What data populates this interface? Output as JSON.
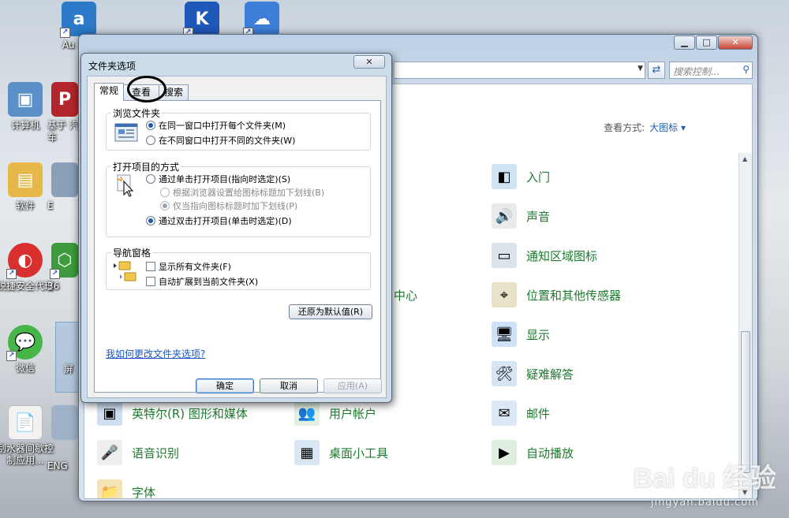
{
  "desktop": {
    "icons": [
      {
        "label": "Au 200",
        "glyph": "a",
        "bg": "#2b79c8"
      },
      {
        "label": "",
        "glyph": "K",
        "bg": "#1f58b8"
      },
      {
        "label": "",
        "glyph": "☁",
        "bg": "#3d7fd8"
      },
      {
        "label": "计算机",
        "glyph": "▣",
        "bg": "#5a8fc8"
      },
      {
        "label": "基于 汽车",
        "glyph": "P",
        "bg": "#b3262b"
      },
      {
        "label": "软件",
        "glyph": "▤",
        "bg": "#e6b84a"
      },
      {
        "label": "E",
        "glyph": "",
        "bg": "transparent"
      },
      {
        "label": "锐捷安全代理",
        "glyph": "◐",
        "bg": "#d92f2f"
      },
      {
        "label": "36",
        "glyph": "⬡",
        "bg": "#3d9b3d"
      },
      {
        "label": "微信",
        "glyph": "💬",
        "bg": "#46b649"
      },
      {
        "label": "屏",
        "glyph": "",
        "bg": "#88a6c8"
      },
      {
        "label": "刮水器间歇控制应用...",
        "glyph": "📄",
        "bg": "#f2f2f2"
      },
      {
        "label": "ENG",
        "glyph": "",
        "bg": "transparent"
      }
    ]
  },
  "control_panel": {
    "search_placeholder": "搜索控制...",
    "view_by_label": "查看方式:",
    "view_by_value": "大图标 ▾",
    "items": [
      {
        "label": "入门",
        "glyph": "◧",
        "bg": "#cfe3f3"
      },
      {
        "label": "机",
        "glyph": "",
        "bg": "transparent"
      },
      {
        "label": "声音",
        "glyph": "🔊",
        "bg": "#eaeaea"
      },
      {
        "label": "通知区域图标",
        "glyph": "▭",
        "bg": "#dde3ea"
      },
      {
        "label": "中心",
        "glyph": "",
        "bg": "transparent"
      },
      {
        "label": "位置和其他传感器",
        "glyph": "⌖",
        "bg": "#e8e2c8"
      },
      {
        "label": "显示",
        "glyph": "🖥",
        "bg": "#cfe1f6"
      },
      {
        "label": "疑难解答",
        "glyph": "🛠",
        "bg": "#d6e4f3"
      },
      {
        "label": "英特尔(R) 图形和媒体",
        "glyph": "▣",
        "bg": "#cfdff0"
      },
      {
        "label": "用户帐户",
        "glyph": "👥",
        "bg": "#e3efe0"
      },
      {
        "label": "邮件",
        "glyph": "✉",
        "bg": "#dce8f5"
      },
      {
        "label": "语音识别",
        "glyph": "🎤",
        "bg": "#eeeeee"
      },
      {
        "label": "桌面小工具",
        "glyph": "▦",
        "bg": "#d9e6f3"
      },
      {
        "label": "自动播放",
        "glyph": "▶",
        "bg": "#e0eee0"
      },
      {
        "label": "字体",
        "glyph": "📁",
        "bg": "#f3e3b5"
      }
    ]
  },
  "dialog": {
    "title": "文件夹选项",
    "close": "✕",
    "tabs": [
      "常规",
      "查看",
      "搜索"
    ],
    "browse_group": {
      "title": "浏览文件夹",
      "options": [
        "在同一窗口中打开每个文件夹(M)",
        "在不同窗口中打开不同的文件夹(W)"
      ]
    },
    "click_group": {
      "title": "打开项目的方式",
      "options": [
        "通过单击打开项目(指向时选定)(S)",
        "根据浏览器设置给图标标题加下划线(B)",
        "仅当指向图标标题时加下划线(P)",
        "通过双击打开项目(单击时选定)(D)"
      ]
    },
    "nav_group": {
      "title": "导航窗格",
      "options": [
        "显示所有文件夹(F)",
        "自动扩展到当前文件夹(X)"
      ]
    },
    "restore_defaults": "还原为默认值(R)",
    "help_link": "我如何更改文件夹选项?",
    "ok": "确定",
    "cancel": "取消",
    "apply": "应用(A)"
  },
  "watermark": {
    "brand": "Bai du 经验",
    "url": "jingyan.baidu.com"
  }
}
